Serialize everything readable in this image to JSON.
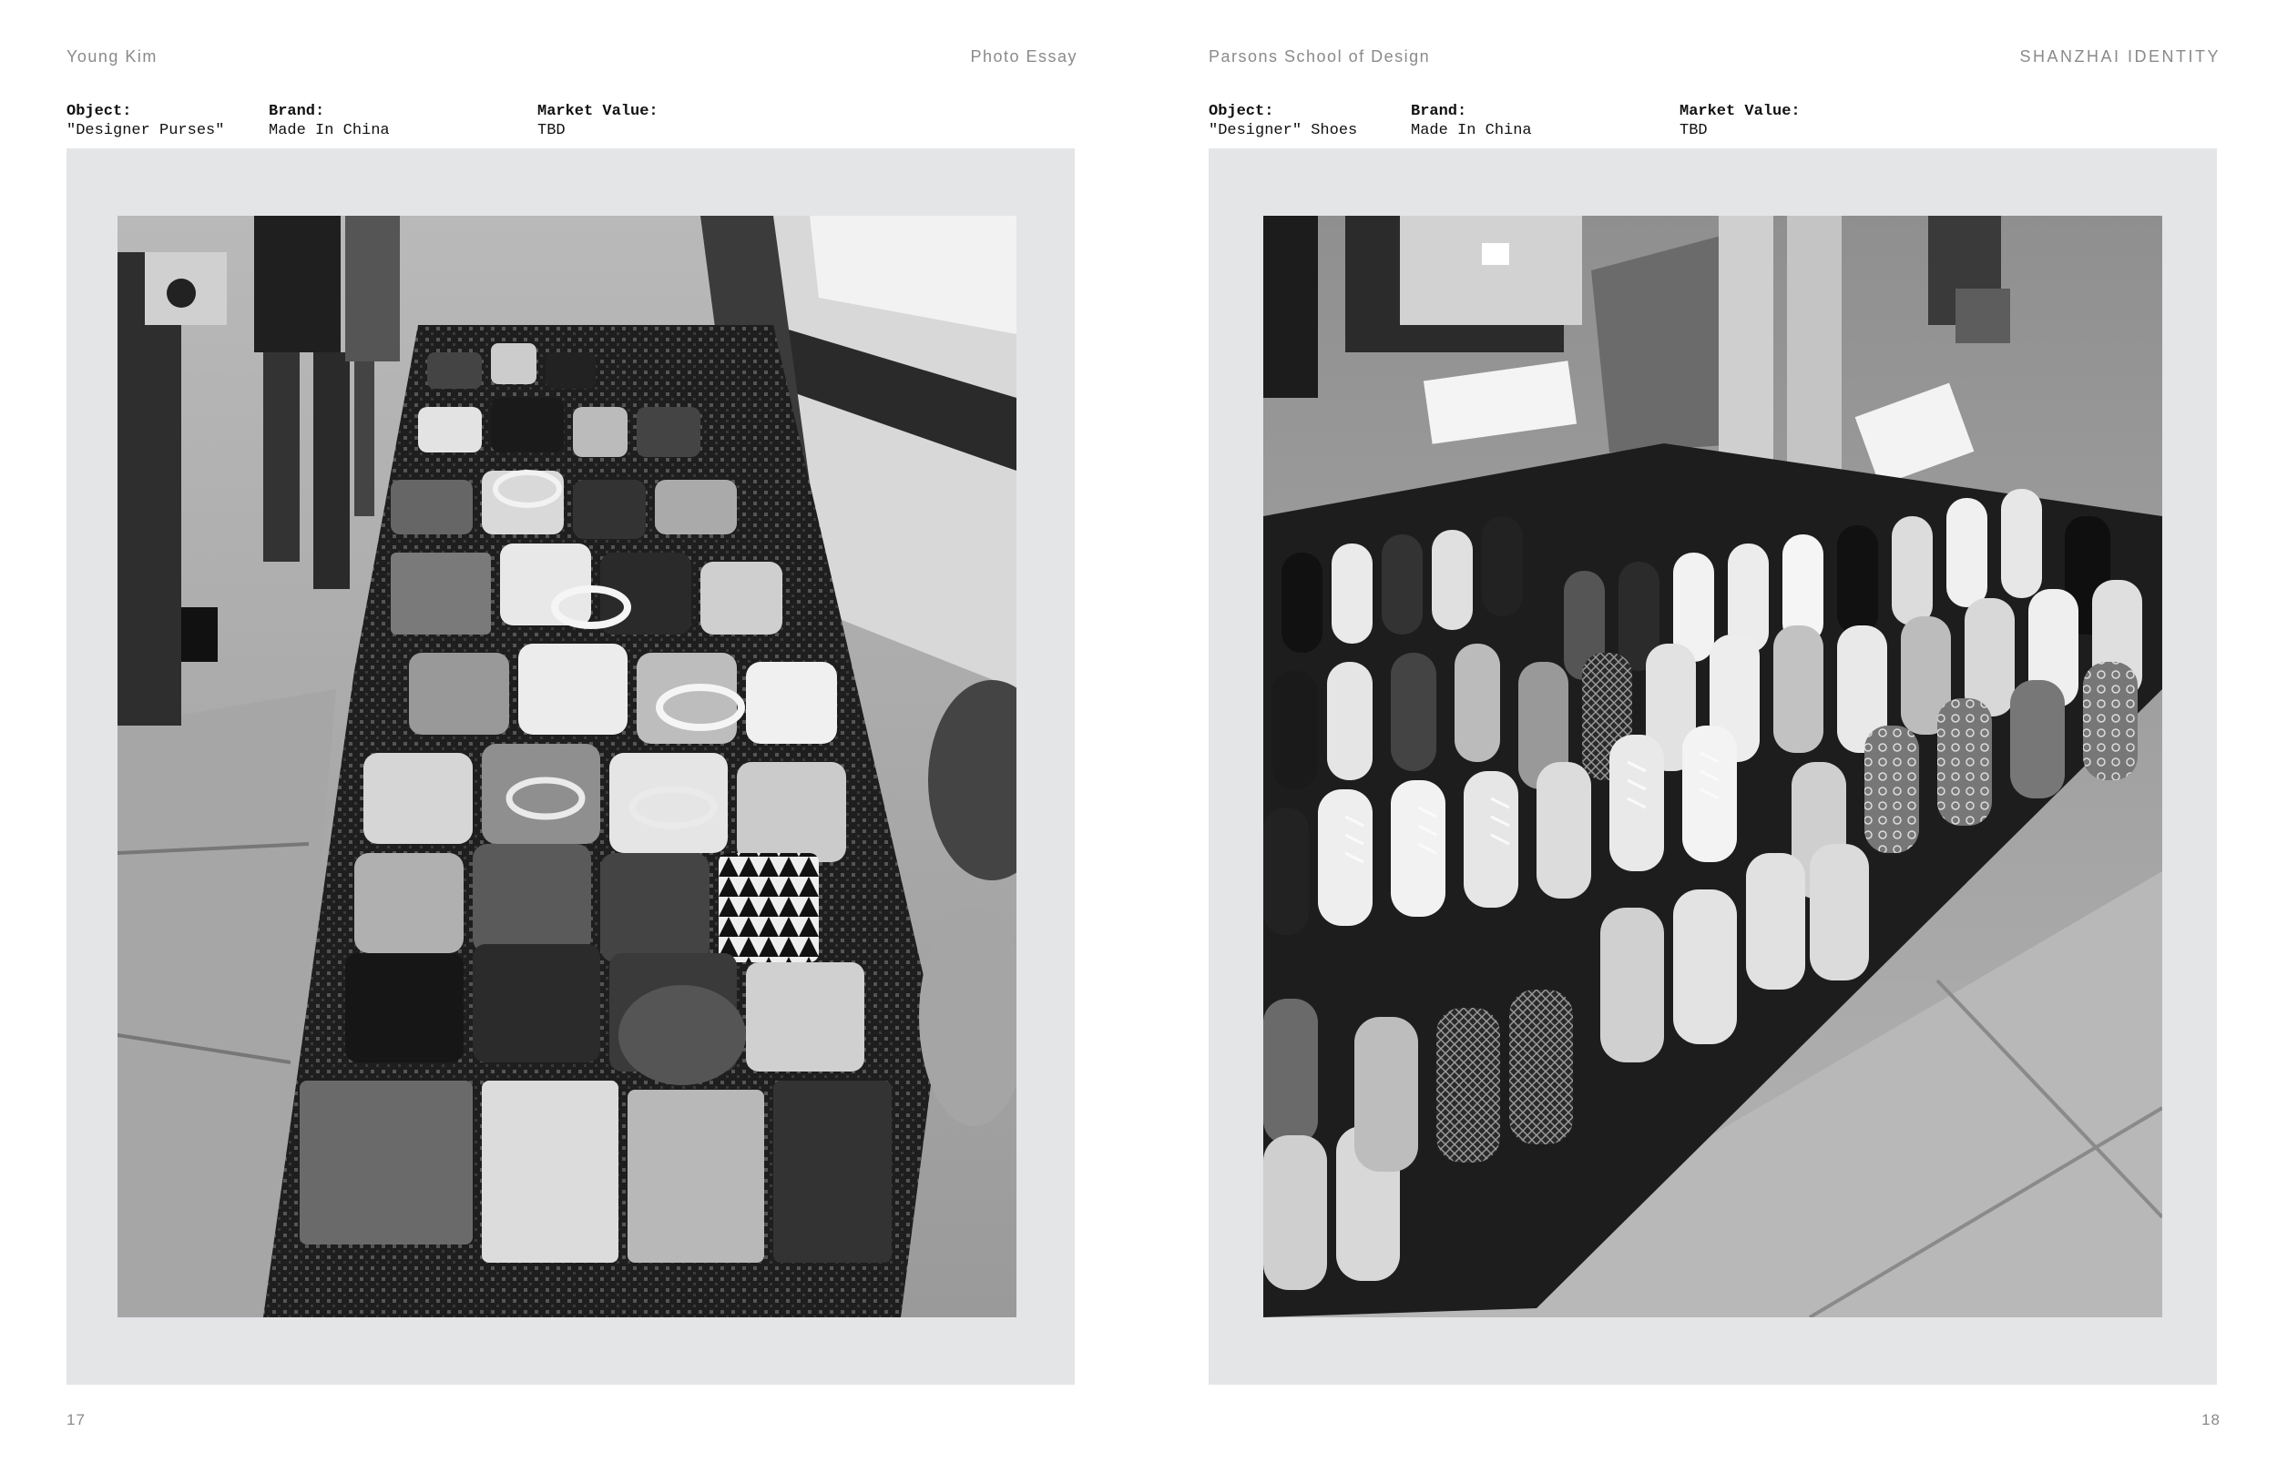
{
  "left_page": {
    "author": "Young Kim",
    "section": "Photo Essay",
    "object_label": "Object:",
    "object_value": "\"Designer Purses\"",
    "brand_label": "Brand:",
    "brand_value": "Made In China",
    "market_label": "Market Value:",
    "market_value": "TBD",
    "page_number": "17",
    "photo_subject": "purses-photo"
  },
  "right_page": {
    "school": "Parsons School of Design",
    "publication": "SHANZHAI IDENTITY",
    "object_label": "Object:",
    "object_value": "\"Designer\" Shoes",
    "brand_label": "Brand:",
    "brand_value": "Made In China",
    "market_label": "Market Value:",
    "market_value": "TBD",
    "page_number": "18",
    "photo_subject": "sneakers-photo"
  },
  "colors": {
    "frame_gray": "#e4e5e7",
    "running_text": "#8a8a8a",
    "body_text": "#111111"
  }
}
